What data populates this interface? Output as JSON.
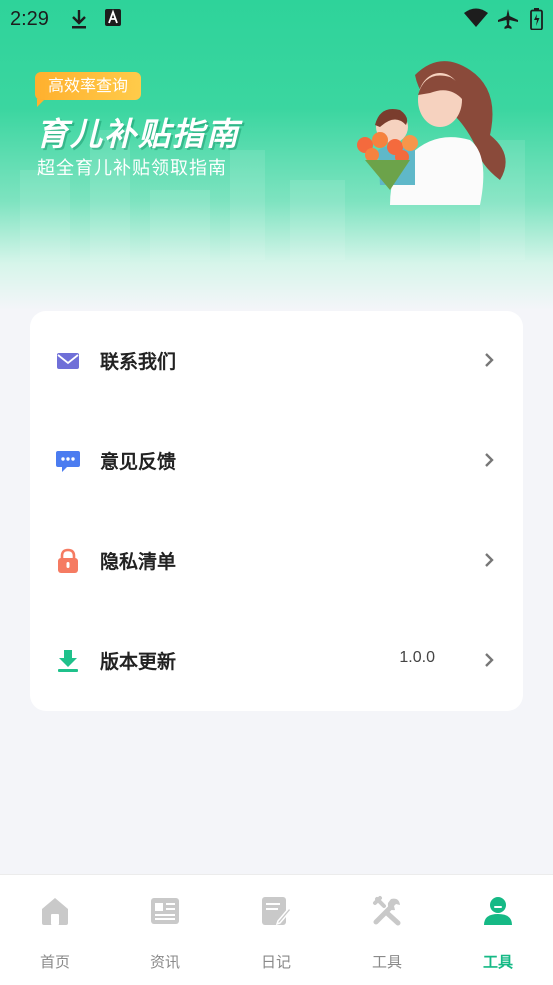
{
  "status_bar": {
    "time": "2:29",
    "icons": [
      "download-icon",
      "keyboard-a-icon",
      "wifi-icon",
      "airplane-icon",
      "battery-icon"
    ]
  },
  "banner": {
    "badge": "高效率查询",
    "title": "育儿补贴指南",
    "subtitle": "超全育儿补贴领取指南"
  },
  "menu": {
    "items": [
      {
        "label": "联系我们",
        "icon": "mail-icon",
        "color": "#6f6fd8",
        "value": ""
      },
      {
        "label": "意见反馈",
        "icon": "chat-bubble-icon",
        "color": "#4b7cf0",
        "value": ""
      },
      {
        "label": "隐私清单",
        "icon": "lock-icon",
        "color": "#f57b62",
        "value": ""
      },
      {
        "label": "版本更新",
        "icon": "download-tray-icon",
        "color": "#1fc18b",
        "value": "1.0.0"
      }
    ]
  },
  "tabbar": {
    "tabs": [
      {
        "label": "首页",
        "icon": "home-icon",
        "active": false
      },
      {
        "label": "资讯",
        "icon": "newspaper-icon",
        "active": false
      },
      {
        "label": "日记",
        "icon": "notebook-edit-icon",
        "active": false
      },
      {
        "label": "工具",
        "icon": "tools-icon",
        "active": false
      },
      {
        "label": "工具",
        "icon": "person-icon",
        "active": true
      }
    ],
    "active_color": "#15b985",
    "inactive_color": "#c9c9c9"
  }
}
